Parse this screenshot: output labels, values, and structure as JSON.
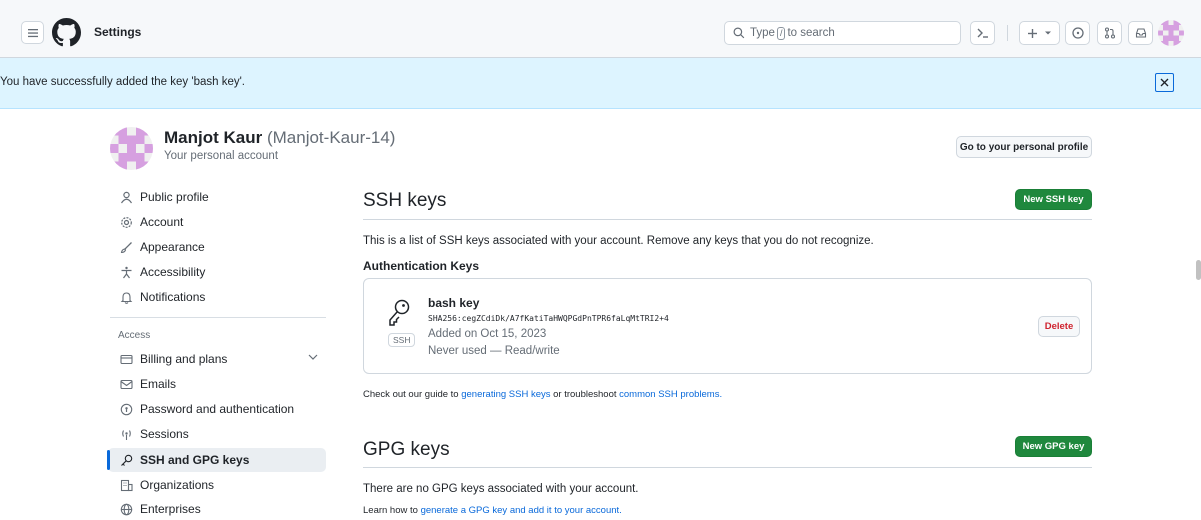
{
  "header": {
    "title": "Settings",
    "search_prefix": "Type",
    "search_key": "/",
    "search_suffix": "to search"
  },
  "flash": {
    "message": "You have successfully added the key 'bash key'."
  },
  "profile": {
    "name": "Manjot Kaur",
    "handle": "(Manjot-Kaur-14)",
    "subtitle": "Your personal account",
    "go_profile_label": "Go to your personal profile"
  },
  "sidebar": {
    "items": [
      {
        "label": "Public profile",
        "icon": "person-icon"
      },
      {
        "label": "Account",
        "icon": "gear-icon"
      },
      {
        "label": "Appearance",
        "icon": "paintbrush-icon"
      },
      {
        "label": "Accessibility",
        "icon": "accessibility-icon"
      },
      {
        "label": "Notifications",
        "icon": "bell-icon"
      }
    ],
    "access_heading": "Access",
    "access_items": [
      {
        "label": "Billing and plans",
        "icon": "credit-card-icon"
      },
      {
        "label": "Emails",
        "icon": "mail-icon"
      },
      {
        "label": "Password and authentication",
        "icon": "shield-lock-icon"
      },
      {
        "label": "Sessions",
        "icon": "broadcast-icon"
      },
      {
        "label": "SSH and GPG keys",
        "icon": "key-icon"
      },
      {
        "label": "Organizations",
        "icon": "organization-icon"
      },
      {
        "label": "Enterprises",
        "icon": "globe-icon"
      }
    ]
  },
  "ssh": {
    "title": "SSH keys",
    "new_button": "New SSH key",
    "description": "This is a list of SSH keys associated with your account. Remove any keys that you do not recognize.",
    "auth_heading": "Authentication Keys",
    "key": {
      "title": "bash key",
      "fingerprint": "SHA256:cegZCdiDk/A7fKatiTaHWQPGdPnTPR6faLqMtTRI2+4",
      "added": "Added on Oct 15, 2023",
      "usage": "Never used — Read/write",
      "badge": "SSH",
      "delete_label": "Delete"
    },
    "guide_prefix": "Check out our guide to",
    "guide_link1": "generating SSH keys",
    "guide_mid": "or troubleshoot",
    "guide_link2": "common SSH problems."
  },
  "gpg": {
    "title": "GPG keys",
    "new_button": "New GPG key",
    "empty": "There are no GPG keys associated with your account.",
    "learn_prefix": "Learn how to",
    "learn_link": "generate a GPG key and add it to your account."
  },
  "colors": {
    "accent": "#0969da",
    "success": "#1f883d",
    "danger": "#cf222e",
    "flash_bg": "#ddf4ff"
  }
}
